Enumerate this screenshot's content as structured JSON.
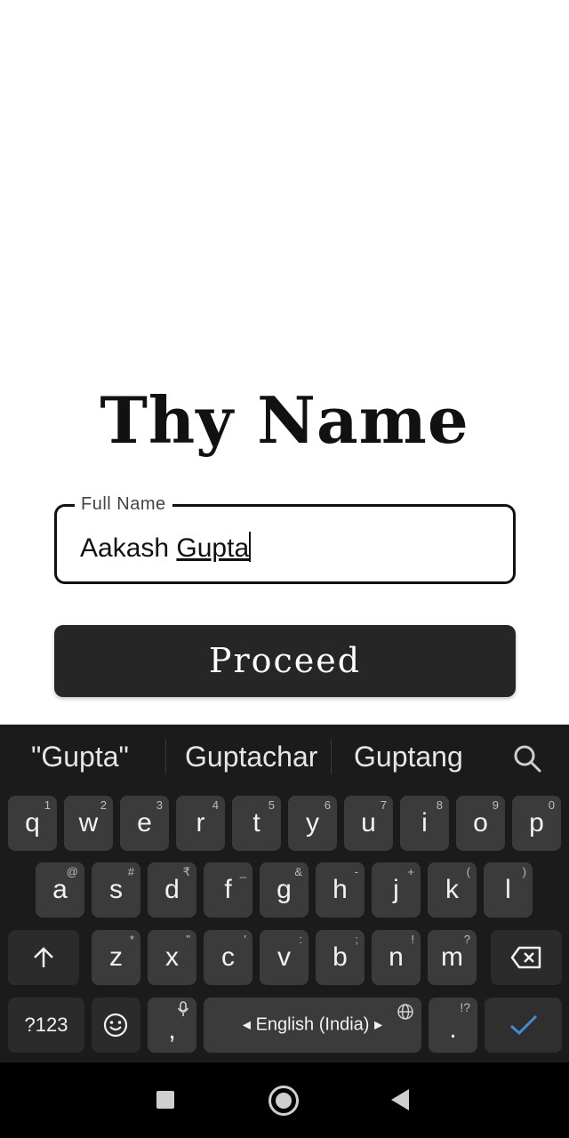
{
  "screen": {
    "title": "Thy Name",
    "field": {
      "label": "Full Name",
      "value_first": "Aakash ",
      "value_second": "Gupta"
    },
    "proceed_label": "Proceed"
  },
  "keyboard": {
    "suggestions": [
      "\"Gupta\"",
      "Guptachar",
      "Guptang"
    ],
    "row1": [
      {
        "k": "q",
        "h": "1"
      },
      {
        "k": "w",
        "h": "2"
      },
      {
        "k": "e",
        "h": "3"
      },
      {
        "k": "r",
        "h": "4"
      },
      {
        "k": "t",
        "h": "5"
      },
      {
        "k": "y",
        "h": "6"
      },
      {
        "k": "u",
        "h": "7"
      },
      {
        "k": "i",
        "h": "8"
      },
      {
        "k": "o",
        "h": "9"
      },
      {
        "k": "p",
        "h": "0"
      }
    ],
    "row2": [
      {
        "k": "a",
        "h": "@"
      },
      {
        "k": "s",
        "h": "#"
      },
      {
        "k": "d",
        "h": "₹"
      },
      {
        "k": "f",
        "h": "_"
      },
      {
        "k": "g",
        "h": "&"
      },
      {
        "k": "h",
        "h": "-"
      },
      {
        "k": "j",
        "h": "+"
      },
      {
        "k": "k",
        "h": "("
      },
      {
        "k": "l",
        "h": ")"
      }
    ],
    "row3": [
      {
        "k": "z",
        "h": "*"
      },
      {
        "k": "x",
        "h": "\""
      },
      {
        "k": "c",
        "h": "'"
      },
      {
        "k": "v",
        "h": ":"
      },
      {
        "k": "b",
        "h": ";"
      },
      {
        "k": "n",
        "h": "!"
      },
      {
        "k": "m",
        "h": "?"
      }
    ],
    "bottom": {
      "symbols_label": "?123",
      "comma_label": ",",
      "space_label": "English (India)",
      "period_label": ".",
      "period_hint": "!?"
    }
  },
  "colors": {
    "keyboard_bg": "#1b1b1b",
    "key_bg": "#3b3b3b",
    "enter_check": "#3d8fd6",
    "button_bg": "#262626"
  }
}
